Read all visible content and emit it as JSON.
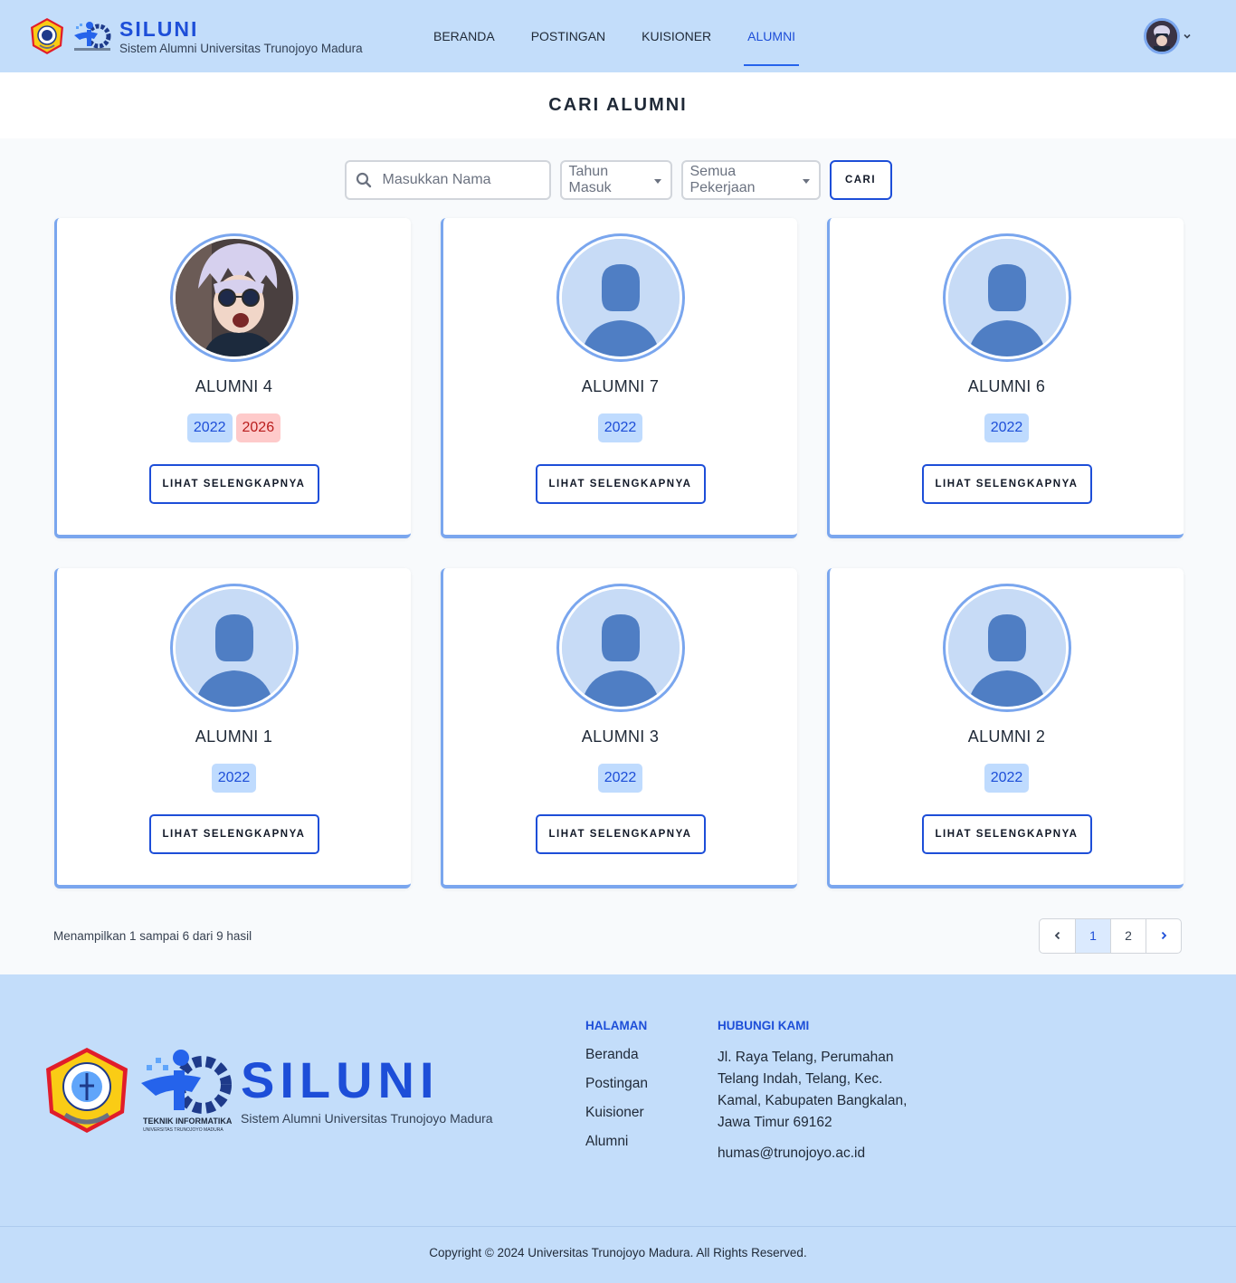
{
  "header": {
    "brand_title": "SILUNI",
    "brand_subtitle": "Sistem Alumni Universitas Trunojoyo Madura",
    "nav": [
      {
        "label": "BERANDA",
        "active": false
      },
      {
        "label": "POSTINGAN",
        "active": false
      },
      {
        "label": "KUISIONER",
        "active": false
      },
      {
        "label": "ALUMNI",
        "active": true
      }
    ]
  },
  "page": {
    "title": "CARI ALUMNI"
  },
  "search": {
    "placeholder": "Masukkan Nama",
    "value": "",
    "year_select": "Tahun Masuk",
    "job_select": "Semua Pekerjaan",
    "button": "CARI"
  },
  "cards": [
    {
      "name": "ALUMNI 4",
      "badges": [
        {
          "text": "2022",
          "color": "blue"
        },
        {
          "text": "2026",
          "color": "red"
        }
      ],
      "photo": "user-photo",
      "button": "LIHAT SELENGKAPNYA"
    },
    {
      "name": "ALUMNI 7",
      "badges": [
        {
          "text": "2022",
          "color": "blue"
        }
      ],
      "photo": "default-avatar-icon",
      "button": "LIHAT SELENGKAPNYA"
    },
    {
      "name": "ALUMNI 6",
      "badges": [
        {
          "text": "2022",
          "color": "blue"
        }
      ],
      "photo": "default-avatar-icon",
      "button": "LIHAT SELENGKAPNYA"
    },
    {
      "name": "ALUMNI 1",
      "badges": [
        {
          "text": "2022",
          "color": "blue"
        }
      ],
      "photo": "default-avatar-icon",
      "button": "LIHAT SELENGKAPNYA"
    },
    {
      "name": "ALUMNI 3",
      "badges": [
        {
          "text": "2022",
          "color": "blue"
        }
      ],
      "photo": "default-avatar-icon",
      "button": "LIHAT SELENGKAPNYA"
    },
    {
      "name": "ALUMNI 2",
      "badges": [
        {
          "text": "2022",
          "color": "blue"
        }
      ],
      "photo": "default-avatar-icon",
      "button": "LIHAT SELENGKAPNYA"
    }
  ],
  "pagination": {
    "summary": "Menampilkan 1 sampai 6 dari 9 hasil",
    "pages": [
      "1",
      "2"
    ],
    "current": "1"
  },
  "footer": {
    "brand_title": "SILUNI",
    "brand_subtitle": "Sistem Alumni Universitas Trunojoyo Madura",
    "ti_logo_text": "TEKNIK INFORMATIKA",
    "ti_logo_sub": "UNIVERSITAS TRUNOJOYO MADURA",
    "pages_heading": "HALAMAN",
    "pages_links": [
      "Beranda",
      "Postingan",
      "Kuisioner",
      "Alumni"
    ],
    "contact_heading": "HUBUNGI KAMI",
    "address": "Jl. Raya Telang, Perumahan Telang Indah, Telang, Kec. Kamal, Kabupaten Bangkalan, Jawa Timur 69162",
    "email": "humas@trunojoyo.ac.id",
    "copyright": "Copyright © 2024 Universitas Trunojoyo Madura. All Rights Reserved."
  },
  "colors": {
    "accent": "#1d4ed8",
    "header_bg": "#c3ddfa",
    "card_border": "#7aa6ee",
    "badge_blue_bg": "#bfdbfe",
    "badge_red_bg": "#fecaca"
  }
}
